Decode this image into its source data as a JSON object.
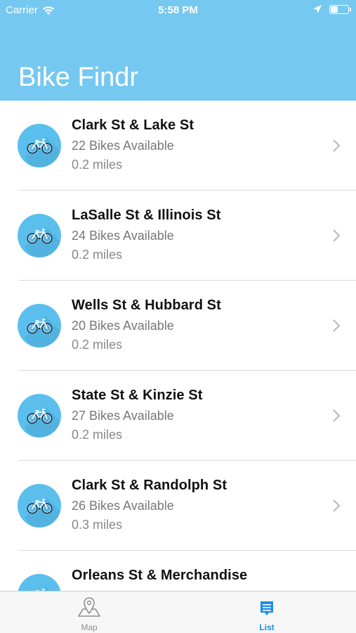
{
  "status_bar": {
    "carrier": "Carrier",
    "time": "5:58 PM"
  },
  "header": {
    "title": "Bike Findr",
    "color": "#75c8f0"
  },
  "stations": [
    {
      "name": "Clark St & Lake St",
      "bikes": "22 Bikes Available",
      "distance": "0.2 miles"
    },
    {
      "name": "LaSalle St & Illinois St",
      "bikes": "24 Bikes Available",
      "distance": "0.2 miles"
    },
    {
      "name": "Wells St & Hubbard St",
      "bikes": "20 Bikes Available",
      "distance": "0.2 miles"
    },
    {
      "name": "State St & Kinzie St",
      "bikes": "27 Bikes Available",
      "distance": "0.2 miles"
    },
    {
      "name": "Clark St & Randolph St",
      "bikes": "26 Bikes Available",
      "distance": "0.3 miles"
    },
    {
      "name": "Orleans St & Merchandise",
      "bikes": "",
      "distance": ""
    }
  ],
  "tabbar": {
    "map_label": "Map",
    "list_label": "List",
    "active_color": "#1e8de6"
  }
}
